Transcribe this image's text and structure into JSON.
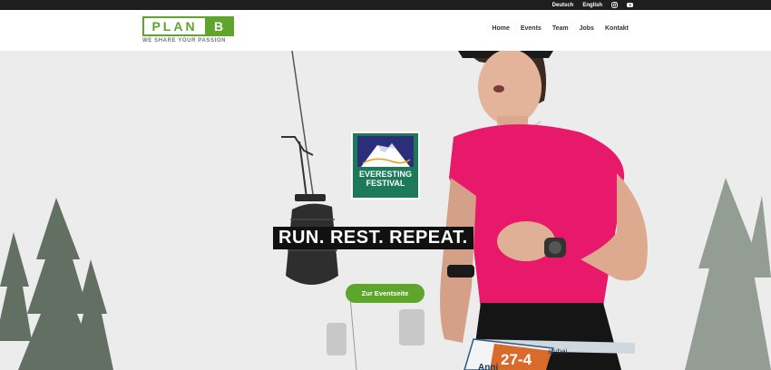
{
  "topbar": {
    "languages": [
      "Deutsch",
      "English"
    ],
    "social": [
      "instagram-icon",
      "youtube-icon"
    ]
  },
  "header": {
    "logo": {
      "word": "PLAN",
      "letter": "B",
      "tagline": "WE SHARE YOUR PASSION"
    },
    "nav": [
      "Home",
      "Events",
      "Team",
      "Jobs",
      "Kontakt"
    ]
  },
  "hero": {
    "festival_logo": {
      "line1": "EVERESTING",
      "line2": "FESTIVAL"
    },
    "headline": "RUN. REST. REPEAT.",
    "cta_label": "Zur Eventseite",
    "bib_number": "27-4",
    "bib_name": "Anni",
    "belt_text": "stubai"
  },
  "colors": {
    "accent": "#5ea52c",
    "topbar": "#1e1e1e",
    "festival": "#1c7a5b",
    "shirt": "#e8196b"
  }
}
